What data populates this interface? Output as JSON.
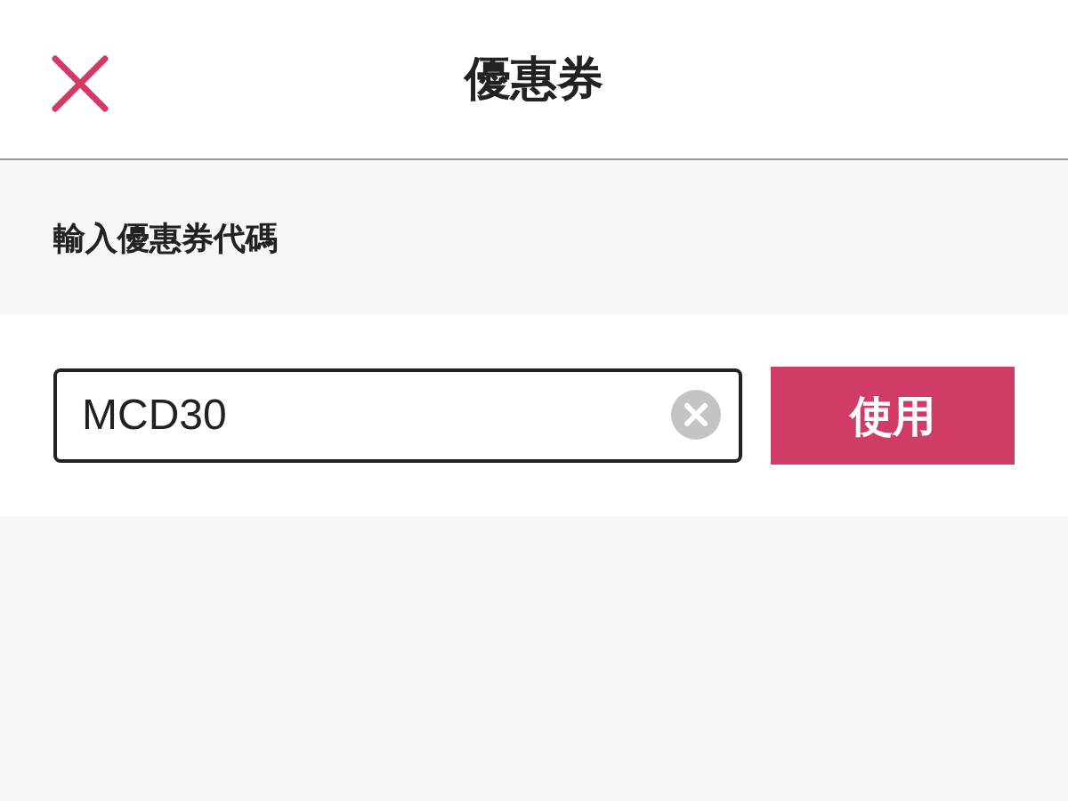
{
  "header": {
    "title": "優惠券"
  },
  "section_label": "輸入優惠券代碼",
  "coupon_field": {
    "value": "MCD30"
  },
  "apply_button": "使用"
}
